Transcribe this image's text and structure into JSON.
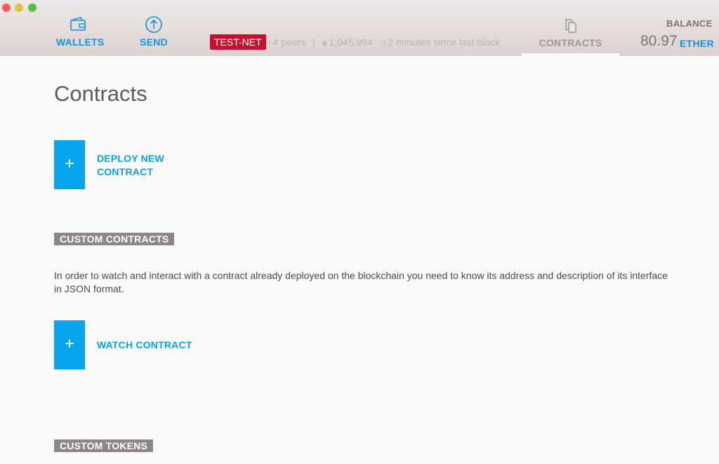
{
  "header": {
    "nav": {
      "wallets_label": "WALLETS",
      "send_label": "SEND",
      "contracts_label": "CONTRACTS"
    },
    "network_badge": "TEST-NET",
    "peers": "4 peers",
    "separator": "|",
    "block_number": "1,045,994",
    "time_since_block": "2 minutes since last block",
    "balance": {
      "label": "BALANCE",
      "value": "80.97",
      "unit": "ETHER"
    },
    "icons": {
      "wallets": "wallet-icon",
      "send": "arrow-up-circle-icon",
      "contracts": "documents-icon",
      "peers": "signal-icon",
      "block": "layers-icon",
      "time": "clock-icon"
    }
  },
  "main": {
    "title": "Contracts",
    "deploy_button": {
      "line1": "DEPLOY NEW",
      "line2": "CONTRACT",
      "icon": "+"
    },
    "custom_contracts_header": "CUSTOM CONTRACTS",
    "description": "In order to watch and interact with a contract already deployed on the blockchain you need to know its address and description of its interface in JSON format.",
    "watch_button": {
      "label": "WATCH CONTRACT",
      "icon": "+"
    },
    "custom_tokens_header": "CUSTOM TOKENS"
  },
  "colors": {
    "accent_blue": "#05a4ec",
    "link_blue": "#1d8fd6",
    "testnet_red": "#c8102e",
    "section_header_bg": "#8e8685"
  }
}
